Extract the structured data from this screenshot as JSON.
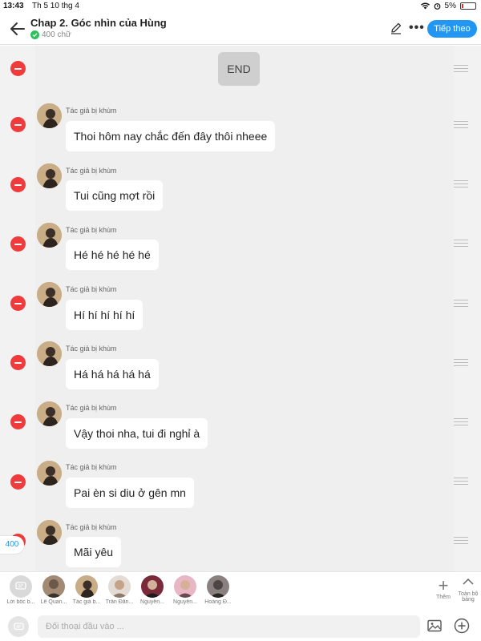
{
  "status": {
    "time": "13:43",
    "date": "Th 5 10 thg 4",
    "battery": "5%"
  },
  "header": {
    "title": "Chap 2. Góc nhìn của Hùng",
    "word_count": "400 chữ",
    "next_label": "Tiếp theo"
  },
  "chat": {
    "end_label": "END",
    "count_badge": "400",
    "messages": [
      {
        "author": "Tác giả bị khùm",
        "text": "Thoi hôm nay chắc đến đây thôi nheee"
      },
      {
        "author": "Tác giả bị khùm",
        "text": "Tui cũng mợt rồi"
      },
      {
        "author": "Tác giả bị khùm",
        "text": "Hé hé hé hé hé"
      },
      {
        "author": "Tác giả bị khùm",
        "text": "Hí hí hí hí hí"
      },
      {
        "author": "Tác giả bị khùm",
        "text": "Há há há há há"
      },
      {
        "author": "Tác giả bị khùm",
        "text": "Vậy thoi nha, tui đi nghỉ à"
      },
      {
        "author": "Tác giả bị khùm",
        "text": "Pai èn si diu ở gên mn"
      },
      {
        "author": "Tác giả bị khùm",
        "text": "Mãi yêu"
      }
    ]
  },
  "characters": [
    {
      "name": "Lời bốc b...",
      "avatar_color": "#d9d9d9"
    },
    {
      "name": "Lê Quan...",
      "avatar_color": "#6b5a4a"
    },
    {
      "name": "Tác giả b...",
      "avatar_color": "#b8976d"
    },
    {
      "name": "Trần Đăn...",
      "avatar_color": "#c4a38a"
    },
    {
      "name": "Nguyễn...",
      "avatar_color": "#3a2f3a"
    },
    {
      "name": "Nguyễn...",
      "avatar_color": "#d88aa0"
    },
    {
      "name": "Hoàng Đ...",
      "avatar_color": "#4d4545"
    }
  ],
  "toolbar": {
    "add_label": "Thêm",
    "fullscreen_label": "Toàn bộ bảng"
  },
  "input": {
    "placeholder": "Đối thoại đầu vào ..."
  },
  "colors": {
    "accent": "#2196f3",
    "delete": "#ef3b3b"
  }
}
